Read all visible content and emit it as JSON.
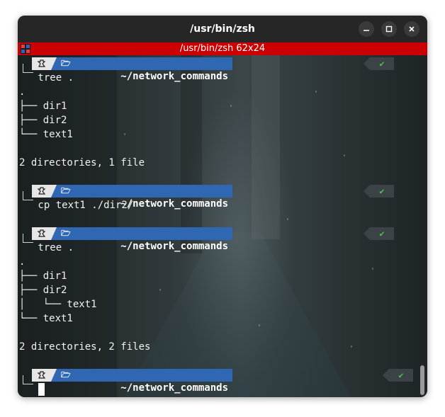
{
  "window": {
    "title": "/usr/bin/zsh",
    "buttons": [
      "minimize-icon",
      "maximize-icon",
      "close-icon"
    ]
  },
  "statusbar": {
    "title": "/usr/bin/zsh 62x24",
    "color": "#cc0000"
  },
  "prompt": {
    "path": "~/network_commands",
    "ok_glyph": "✔",
    "os_icon": "penguin-icon",
    "folder_icon": "folder-icon"
  },
  "terminal": {
    "lines": [
      " tree .",
      ".",
      "├── dir1",
      "├── dir2",
      "└── text1",
      "",
      "2 directories, 1 file",
      "",
      " cp text1 ./dir2/",
      "",
      " tree .",
      ".",
      "├── dir1",
      "├── dir2",
      "│   └── text1",
      "└── text1",
      "",
      "2 directories, 2 files"
    ]
  },
  "colors": {
    "accent": "#2f67b2",
    "ok": "#50c050",
    "statusbar": "#cc0000"
  }
}
